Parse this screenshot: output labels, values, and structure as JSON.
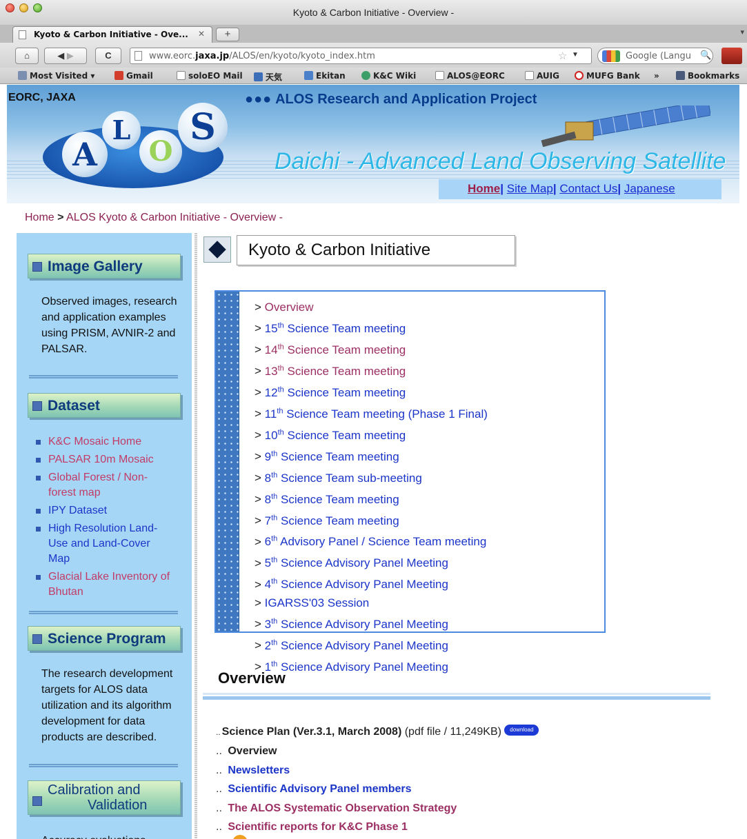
{
  "browser": {
    "window_title": "Kyoto & Carbon Initiative - Overview -",
    "tab_label": "Kyoto & Carbon Initiative - Ove...",
    "new_tab": "+",
    "url_host": "www.eorc.",
    "url_domain": "jaxa.jp",
    "url_path": "/ALOS/en/kyoto/kyoto_index.htm",
    "search_placeholder": "Google (Langu",
    "bookmarks": [
      "Most Visited",
      "Gmail",
      "soloEO Mail",
      "天気",
      "Ekitan",
      "K&C Wiki",
      "ALOS@EORC",
      "AUIG",
      "MUFG Bank",
      "»",
      "Bookmarks"
    ]
  },
  "header": {
    "brand": "EORC, JAXA",
    "project_dots": "●●●",
    "project_title": "ALOS Research and Application Project",
    "logo_letters": [
      "A",
      "L",
      "O",
      "S"
    ],
    "tagline": "Daichi - Advanced Land Observing Satellite",
    "nav": [
      "Home",
      "Site Map",
      "Contact Us",
      "Japanese"
    ],
    "nav_sep": "|"
  },
  "breadcrumb": {
    "home": "Home",
    "sep": ">",
    "current": "ALOS Kyoto & Carbon Initiative - Overview -"
  },
  "sidebar": {
    "gallery": {
      "title": "Image Gallery",
      "text": "Observed images, research and application examples using PRISM, AVNIR-2 and PALSAR."
    },
    "dataset": {
      "title": "Dataset",
      "items": [
        {
          "label": "K&C Mosaic Home",
          "visited": true
        },
        {
          "label": "PALSAR 10m Mosaic",
          "visited": true
        },
        {
          "label": "Global Forest / Non-forest map",
          "visited": true
        },
        {
          "label": "IPY Dataset",
          "visited": false
        },
        {
          "label": "High Resolution Land-Use and Land-Cover Map",
          "visited": false
        },
        {
          "label": "Glacial Lake Inventory of Bhutan",
          "visited": true
        }
      ]
    },
    "science": {
      "title": "Science Program",
      "text": "The research development targets for ALOS data utilization and its algorithm development for data products are described."
    },
    "calibration": {
      "title_line1": "Calibration and",
      "title_line2": "Validation",
      "text": "Accuracy evaluations"
    }
  },
  "main": {
    "section_title": "Kyoto & Carbon Initiative",
    "meetings": [
      {
        "num": "",
        "sup": "",
        "text": "Overview",
        "visited": true
      },
      {
        "num": "15",
        "sup": "th",
        "text": "Science Team meeting",
        "visited": false
      },
      {
        "num": "14",
        "sup": "th",
        "text": "Science Team meeting",
        "visited": true
      },
      {
        "num": "13",
        "sup": "th",
        "text": "Science Team meeting",
        "visited": true
      },
      {
        "num": "12",
        "sup": "th",
        "text": "Science Team meeting",
        "visited": false
      },
      {
        "num": "11",
        "sup": "th",
        "text": "Science Team meeting (Phase 1 Final)",
        "visited": false
      },
      {
        "num": "10",
        "sup": "th",
        "text": "Science Team meeting",
        "visited": false
      },
      {
        "num": "9",
        "sup": "th",
        "text": "Science Team meeting",
        "visited": false
      },
      {
        "num": "8",
        "sup": "th",
        "text": "Science Team sub-meeting",
        "visited": false
      },
      {
        "num": "8",
        "sup": "th",
        "text": "Science Team meeting",
        "visited": false
      },
      {
        "num": "7",
        "sup": "th",
        "text": "Science Team meeting",
        "visited": false
      },
      {
        "num": "6",
        "sup": "th",
        "text": "Advisory Panel / Science Team meeting",
        "visited": false
      },
      {
        "num": "5",
        "sup": "th",
        "text": "Science Advisory Panel Meeting",
        "visited": false
      },
      {
        "num": "4",
        "sup": "th",
        "text": "Science Advisory Panel Meeting",
        "visited": false
      },
      {
        "num": "",
        "sup": "",
        "text": "IGARSS'03 Session",
        "visited": false
      },
      {
        "num": "3",
        "sup": "th",
        "text": "Science Advisory Panel Meeting",
        "visited": false
      },
      {
        "num": "2",
        "sup": "th",
        "text": "Science Advisory Panel Meeting",
        "visited": false
      },
      {
        "num": "1",
        "sup": "th",
        "text": "Science Advisory Panel Meeting",
        "visited": false
      }
    ],
    "overview_heading": "Overview",
    "science_plan_title": "Science Plan (Ver.3.1, March 2008)",
    "science_plan_meta": "(pdf file / 11,249KB)",
    "download_badge": "download",
    "resources": [
      {
        "label": "Overview",
        "kind": "plain"
      },
      {
        "label": "Newsletters",
        "kind": "link"
      },
      {
        "label": "Scientific Advisory Panel members",
        "kind": "link"
      },
      {
        "label": "The ALOS Systematic Observation Strategy",
        "kind": "visited"
      },
      {
        "label": "Scientific reports for K&C Phase 1",
        "kind": "visited"
      }
    ]
  }
}
